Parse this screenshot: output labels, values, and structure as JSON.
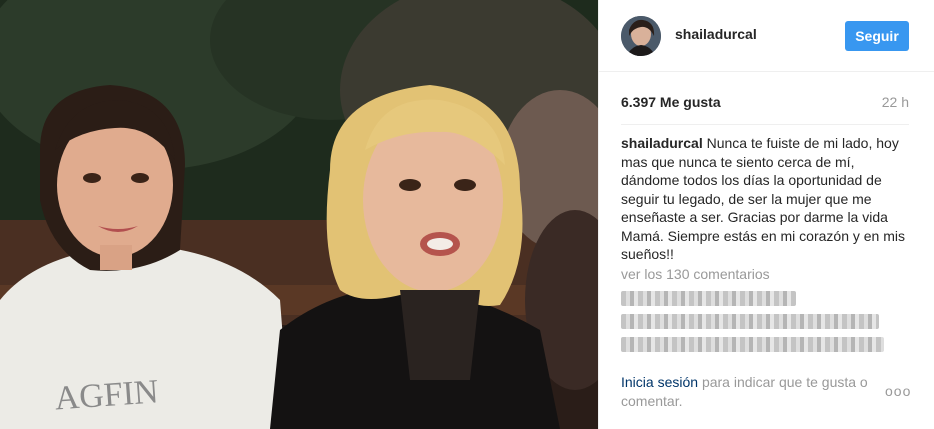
{
  "post": {
    "username": "shailadurcal",
    "follow_label": "Seguir",
    "likes": "6.397 Me gusta",
    "time_ago": "22 h",
    "caption_user": "shailadurcal",
    "caption_text": "Nunca te fuiste de mi lado, hoy mas que nunca te siento cerca de mí, dándome todos los días la oportunidad de seguir tu legado, de ser la mujer que me enseñaste a ser. Gracias por darme la vida Mamá. Siempre estás en mi corazón y en mis sueños!!",
    "view_comments": "ver los 130 comentarios",
    "login_link": "Inicia sesión",
    "login_rest": "para indicar que te gusta o comentar.",
    "more_label": "ooo"
  },
  "colors": {
    "follow_button": "#3897f0",
    "link": "#003569",
    "muted": "#999999"
  },
  "icons": {
    "more": "more-options-icon"
  }
}
